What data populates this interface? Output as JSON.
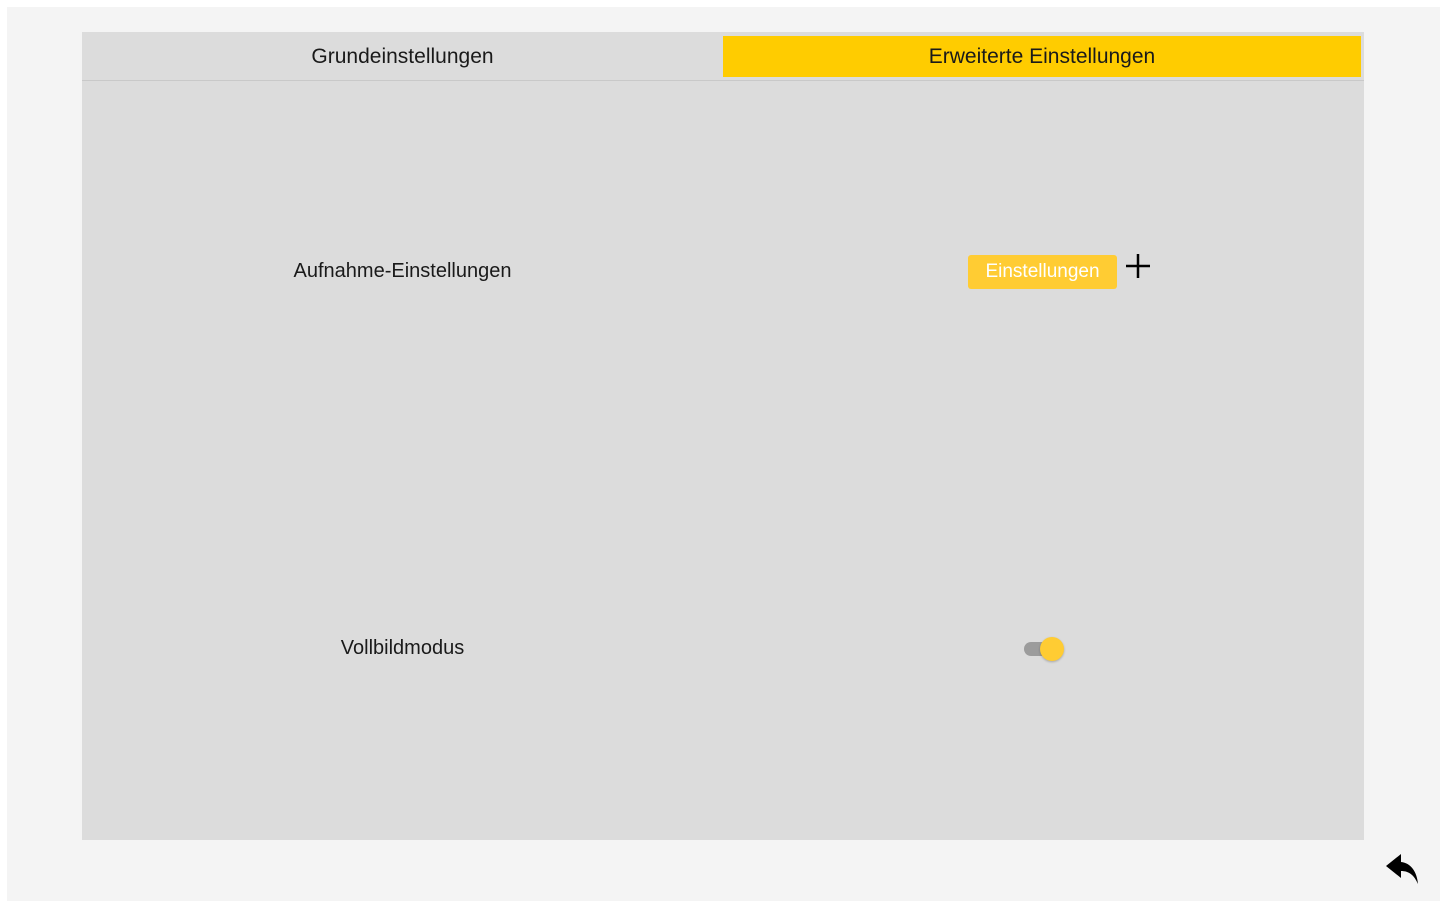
{
  "tabs": {
    "basic_label": "Grundeinstellungen",
    "advanced_label": "Erweiterte Einstellungen",
    "active": "advanced"
  },
  "settings": {
    "recording": {
      "label": "Aufnahme-Einstellungen",
      "button_label": "Einstellungen"
    },
    "fullscreen": {
      "label": "Vollbildmodus",
      "enabled": true
    }
  },
  "icons": {
    "back": "back-arrow-icon",
    "cursor": "crosshair-cursor-icon"
  },
  "colors": {
    "accent": "#ffcc00",
    "button": "#ffcc33",
    "panel": "#dcdcdc",
    "background": "#f4f4f4"
  }
}
